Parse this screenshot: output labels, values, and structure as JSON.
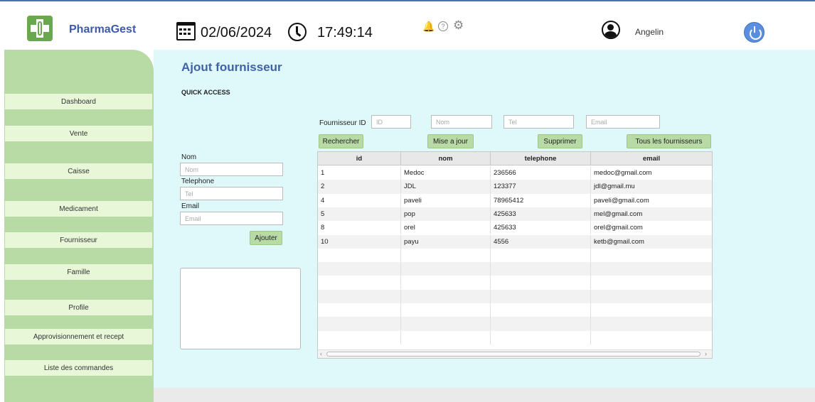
{
  "app": {
    "brand": "PharmaGest"
  },
  "header": {
    "date": "02/06/2024",
    "time": "17:49:14",
    "user": "Angelin",
    "icons": [
      "calendar-icon",
      "clock-icon",
      "bell-icon",
      "help-icon",
      "gear-icon",
      "user-avatar-icon",
      "power-icon"
    ]
  },
  "sidebar": {
    "items": [
      {
        "label": "Dashboard"
      },
      {
        "label": "Vente"
      },
      {
        "label": "Caisse"
      },
      {
        "label": "Medicament"
      },
      {
        "label": "Fournisseur"
      },
      {
        "label": "Famille"
      },
      {
        "label": "Profile"
      },
      {
        "label": "Approvisionnement et recept"
      },
      {
        "label": "Liste des commandes"
      }
    ]
  },
  "page": {
    "title": "Ajout fournisseur",
    "quick_access": "QUICK ACCESS"
  },
  "form": {
    "nom_label": "Nom",
    "nom_placeholder": "Nom",
    "tel_label": "Telephone",
    "tel_placeholder": "Tel",
    "email_label": "Email",
    "email_placeholder": "Email",
    "add_label": "Ajouter"
  },
  "search": {
    "id_label": "Fournisseur ID",
    "id_placeholder": "ID",
    "nom_placeholder": "Nom",
    "tel_placeholder": "Tel",
    "email_placeholder": "Email",
    "search_label": "Rechercher",
    "update_label": "Mise a jour",
    "delete_label": "Supprimer",
    "all_label": "Tous les fournisseurs"
  },
  "table": {
    "columns": [
      "id",
      "nom",
      "telephone",
      "email"
    ],
    "rows": [
      [
        "1",
        "Medoc",
        "236566",
        "medoc@gmail.com"
      ],
      [
        "2",
        "JDL",
        "123377",
        "jdl@gmail.mu"
      ],
      [
        "4",
        "paveli",
        "78965412",
        "paveli@gmail.com"
      ],
      [
        "5",
        "pop",
        "425633",
        "mel@gmail.com"
      ],
      [
        "8",
        "orel",
        "425633",
        "orel@gmail.com"
      ],
      [
        "10",
        "payu",
        "4556",
        "ketb@gmail.com"
      ]
    ]
  }
}
